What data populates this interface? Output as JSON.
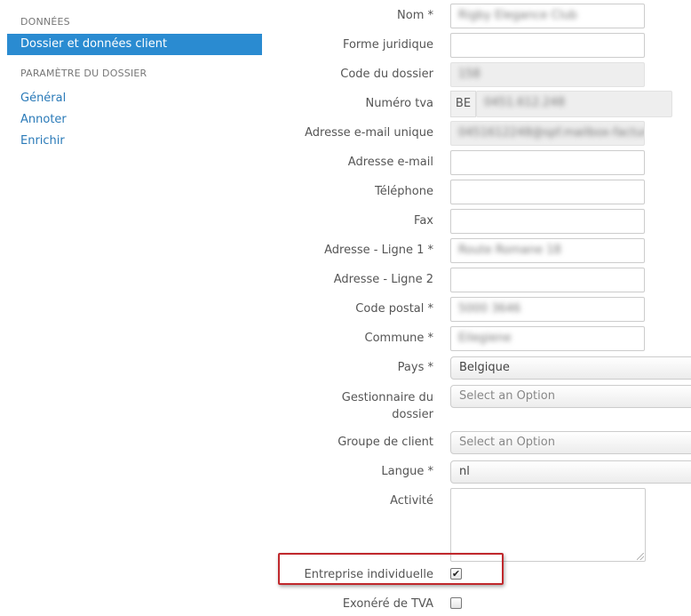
{
  "sidebar": {
    "section1_title": "DONNÉES",
    "active_item": "Dossier et données client",
    "section2_title": "PARAMÈTRE DU DOSSIER",
    "links": [
      "Général",
      "Annoter",
      "Enrichir"
    ]
  },
  "form": {
    "nom": {
      "label": "Nom *",
      "value": "Rigby Elegance Club"
    },
    "forme_juridique": {
      "label": "Forme juridique",
      "value": ""
    },
    "code_dossier": {
      "label": "Code du dossier",
      "value": "158"
    },
    "numero_tva": {
      "label": "Numéro tva",
      "prefix": "BE",
      "value": "0451.612.248"
    },
    "adresse_email_unique": {
      "label": "Adresse e-mail unique",
      "value": "0451612248@spf.mailbox-facture.be"
    },
    "adresse_email": {
      "label": "Adresse e-mail",
      "value": ""
    },
    "telephone": {
      "label": "Téléphone",
      "value": ""
    },
    "fax": {
      "label": "Fax",
      "value": ""
    },
    "adresse1": {
      "label": "Adresse - Ligne 1 *",
      "value": "Route Romane 18"
    },
    "adresse2": {
      "label": "Adresse - Ligne 2",
      "value": ""
    },
    "code_postal": {
      "label": "Code postal *",
      "value": "5000 3646"
    },
    "commune": {
      "label": "Commune *",
      "value": "Eilegiene"
    },
    "pays": {
      "label": "Pays *",
      "value": "Belgique"
    },
    "gestionnaire": {
      "label": "Gestionnaire du dossier",
      "placeholder": "Select an Option"
    },
    "groupe_client": {
      "label": "Groupe de client",
      "placeholder": "Select an Option"
    },
    "langue": {
      "label": "Langue *",
      "value": "nl"
    },
    "activite": {
      "label": "Activité",
      "value": ""
    },
    "entreprise_individuelle": {
      "label": "Entreprise individuelle",
      "checked": true,
      "mark": "✔"
    },
    "exonere_tva": {
      "label": "Exonéré de TVA",
      "checked": false
    }
  },
  "colors": {
    "accent": "#2a8bd1",
    "highlight": "#c0282c"
  }
}
